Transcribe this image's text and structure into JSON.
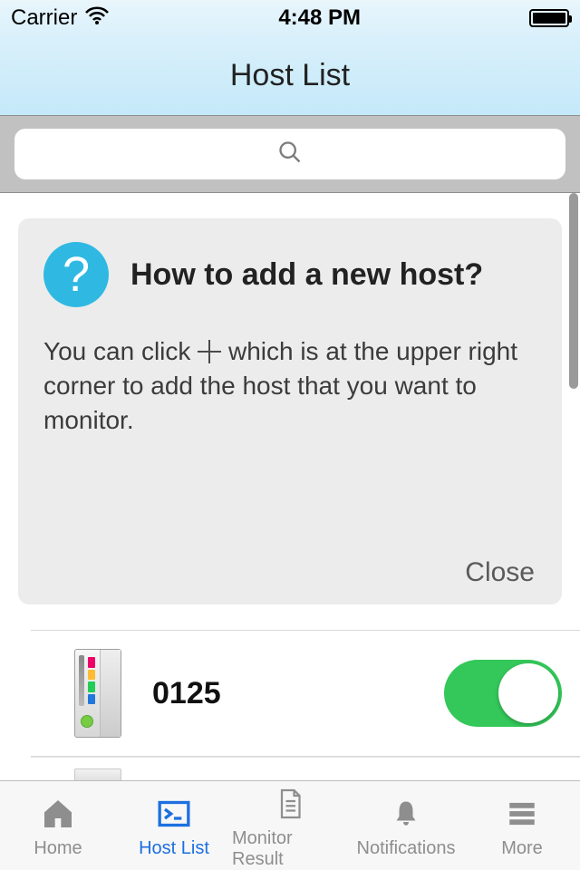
{
  "status": {
    "carrier": "Carrier",
    "time": "4:48 PM"
  },
  "header": {
    "title": "Host List"
  },
  "search": {
    "placeholder": ""
  },
  "tip": {
    "title": "How to add a new host?",
    "body_pre": "You can click ",
    "body_post": " which is at the upper right corner to add the host that you want to monitor.",
    "close": "Close"
  },
  "hosts": [
    {
      "name": "0125",
      "enabled": true
    }
  ],
  "tabs": {
    "home": "Home",
    "hostlist": "Host List",
    "monitor": "Monitor Result",
    "notifications": "Notifications",
    "more": "More"
  }
}
